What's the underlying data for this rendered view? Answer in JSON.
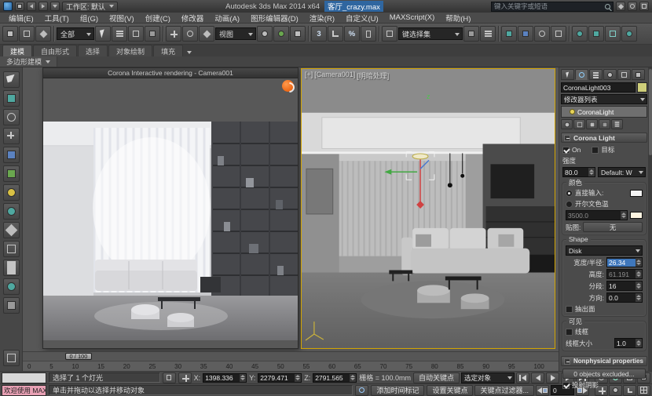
{
  "titlebar": {
    "workspace": "工作区: 默认",
    "app_title": "Autodesk 3ds Max 2014 x64",
    "file_name": "客厅_crazy.max",
    "search_placeholder": "键入关键字或短语"
  },
  "menubar": {
    "items": [
      "编辑(E)",
      "工具(T)",
      "组(G)",
      "视图(V)",
      "创建(C)",
      "修改器",
      "动画(A)",
      "图形编辑器(D)",
      "渲染(R)",
      "自定义(U)",
      "MAXScript(X)",
      "帮助(H)"
    ]
  },
  "toolbar": {
    "selection_filter": "全部",
    "ref_coord": "视图",
    "snap_label": "3",
    "percent_label": "%",
    "named_sets": "键选择集"
  },
  "ribbon": {
    "tabs": [
      "建模",
      "自由形式",
      "选择",
      "对象绘制",
      "填充"
    ],
    "sub_label": "多边形建模"
  },
  "viewport": {
    "corona_title": "Corona Interactive rendering - Camera001",
    "label_plus": "[+]",
    "label_camera": "[Camera001]",
    "label_shading": "[明暗处理]",
    "axis_label": "z"
  },
  "timeline": {
    "slider_label": "0 / 100",
    "ticks": [
      "0",
      "5",
      "10",
      "15",
      "20",
      "25",
      "30",
      "35",
      "40",
      "45",
      "50",
      "55",
      "60",
      "65",
      "70",
      "75",
      "80",
      "85",
      "90",
      "95",
      "100"
    ]
  },
  "panel": {
    "object_name": "CoronaLight003",
    "modifier_list": "修改器列表",
    "stack_item": "CoronaLight",
    "light": {
      "title": "Corona Light",
      "on": "On",
      "target": "目标",
      "intensity": "强度",
      "intensity_value": "80.0",
      "units": "Default: W",
      "color_group": "颜色",
      "direct_input": "直接输入:",
      "kelvin": "开尔文色温",
      "kelvin_value": "3500.0",
      "map": "贴图:",
      "map_value": "无"
    },
    "shape": {
      "group": "Shape",
      "type": "Disk",
      "width_label": "宽度/半径: ",
      "width_value": "26.34",
      "height_label": "高度:",
      "height_value": "61.191",
      "segments_label": "分段:",
      "segments_value": "16",
      "direction_label": "方向:",
      "direction_value": "0.0",
      "emit_label": "抽出面"
    },
    "visible": {
      "group": "可见",
      "wireframe": "线框",
      "wire_size_label": "线框大小",
      "wire_size_value": "1.0"
    },
    "nonphysical": {
      "title": "Nonphysical properties",
      "exclude": "0 objects excluded...",
      "shadows": "投射阴影"
    }
  },
  "status": {
    "listener_text": "欢迎使用 MAXScript",
    "selection": "选择了 1 个灯光",
    "prompt": "单击并拖动以选择并移动对象",
    "x_label": "X:",
    "x_value": "1398.336",
    "y_label": "Y:",
    "y_value": "2279.471",
    "z_label": "Z:",
    "z_value": "2791.565",
    "grid": "栅格 = 100.0mm",
    "add_time_tag": "添加时间标记",
    "auto_key": "自动关键点",
    "selected_mode": "选定对象",
    "set_key": "设置关键点",
    "key_filters": "关键点过滤器...",
    "frame_value": "0"
  }
}
